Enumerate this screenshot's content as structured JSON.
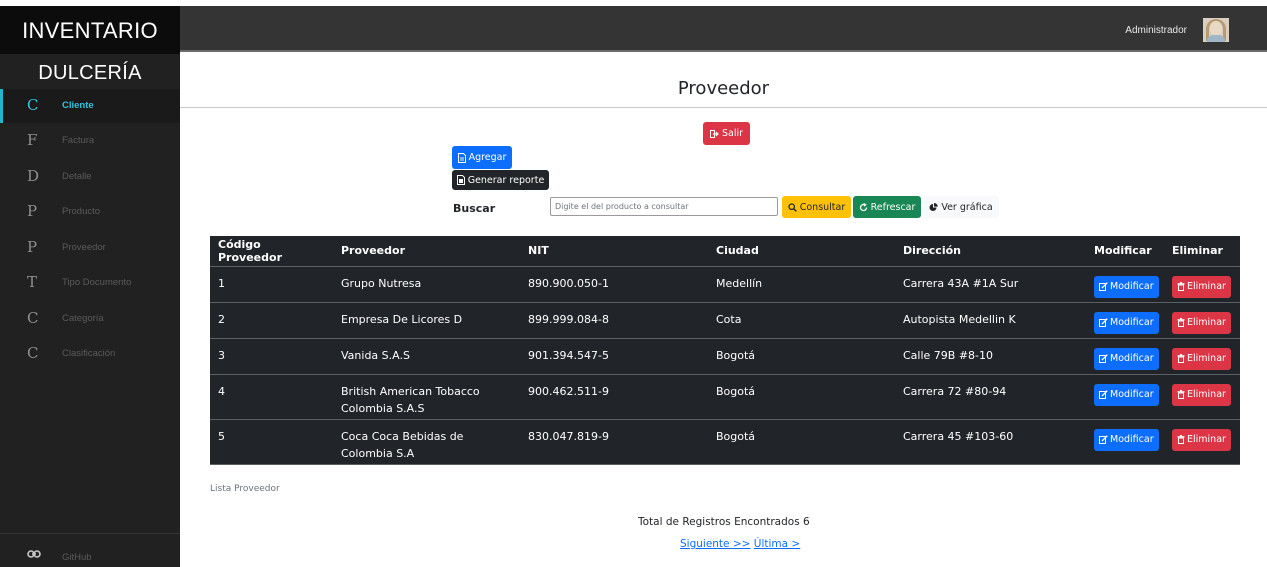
{
  "sidebar": {
    "title": "INVENTARIO",
    "subtitle": "DULCERÍA",
    "items": [
      {
        "letter": "C",
        "label": "Cliente"
      },
      {
        "letter": "F",
        "label": "Factura"
      },
      {
        "letter": "D",
        "label": "Detalle"
      },
      {
        "letter": "P",
        "label": "Producto"
      },
      {
        "letter": "P",
        "label": "Proveedor"
      },
      {
        "letter": "T",
        "label": "Tipo Documento"
      },
      {
        "letter": "C",
        "label": "Categoría"
      },
      {
        "letter": "C",
        "label": "Clasificación"
      }
    ],
    "footer_label": "GitHub",
    "accent_color": "#23b7cf"
  },
  "topbar": {
    "user": "Administrador"
  },
  "page": {
    "title": "Proveedor"
  },
  "actions": {
    "salir": "Salir",
    "agregar": "Agregar",
    "reporte": "Generar reporte"
  },
  "search": {
    "label": "Buscar",
    "placeholder": "Digite el del producto a consultar",
    "consultar": "Consultar",
    "refrescar": "Refrescar",
    "grafica": "Ver gráfica"
  },
  "table": {
    "headers": [
      "Código Proveedor",
      "Proveedor",
      "NIT",
      "Ciudad",
      "Dirección",
      "Modificar",
      "Eliminar"
    ],
    "rows": [
      {
        "codigo": "1",
        "proveedor": "Grupo Nutresa",
        "nit": "890.900.050-1",
        "ciudad": "Medellín",
        "direccion": "Carrera 43A #1A Sur"
      },
      {
        "codigo": "2",
        "proveedor": "Empresa De Licores D",
        "nit": "899.999.084-8",
        "ciudad": "Cota",
        "direccion": "Autopista Medellin K"
      },
      {
        "codigo": "3",
        "proveedor": "Vanida S.A.S",
        "nit": "901.394.547-5",
        "ciudad": "Bogotá",
        "direccion": "Calle 79B #8-10"
      },
      {
        "codigo": "4",
        "proveedor": "British American Tobacco Colombia S.A.S",
        "nit": "900.462.511-9",
        "ciudad": "Bogotá",
        "direccion": "Carrera 72 #80-94"
      },
      {
        "codigo": "5",
        "proveedor": "Coca Coca Bebidas de Colombia S.A",
        "nit": "830.047.819-9",
        "ciudad": "Bogotá",
        "direccion": "Carrera 45 #103-60"
      }
    ],
    "modificar_label": "Modificar",
    "eliminar_label": "Eliminar",
    "caption": "Lista Proveedor"
  },
  "footer": {
    "total": "Total de Registros Encontrados 6",
    "siguiente": "Siguiente >>",
    "ultima": "Última >"
  }
}
